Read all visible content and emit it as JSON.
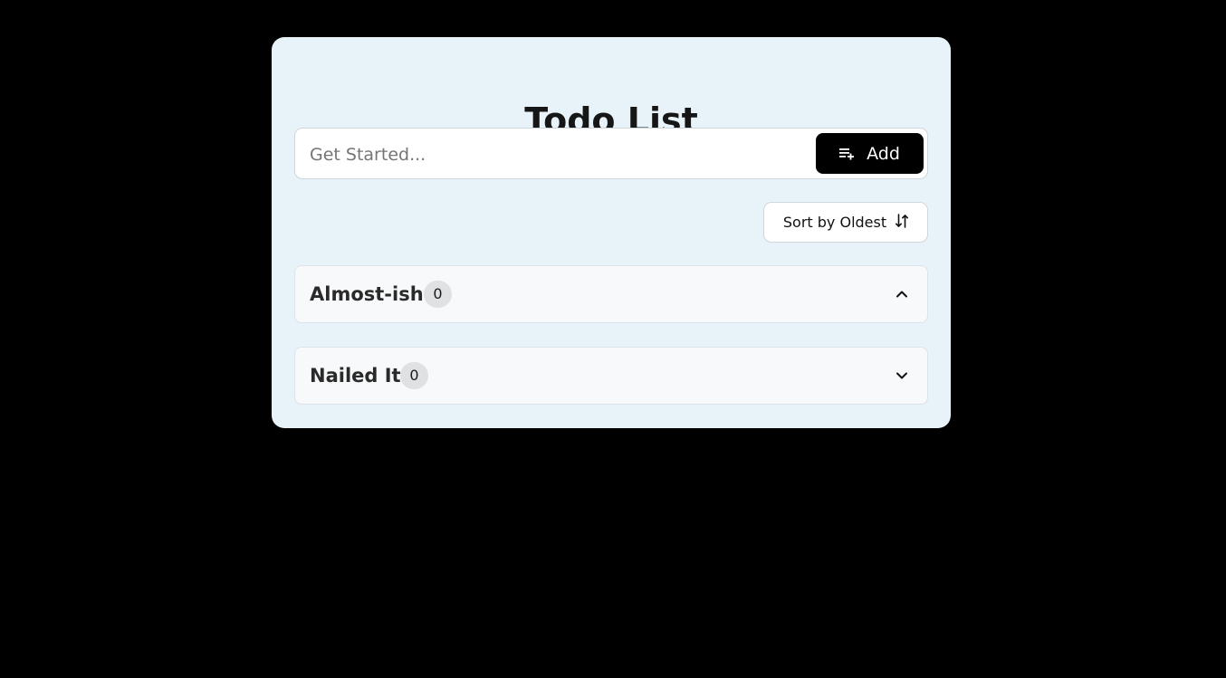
{
  "app": {
    "title": "Todo List"
  },
  "input": {
    "placeholder": "Get Started...",
    "value": ""
  },
  "add_button": {
    "label": "Add",
    "icon": "playlist-add-icon"
  },
  "sort_button": {
    "label": "Sort by Oldest",
    "icon": "sort-arrows-icon"
  },
  "sections": [
    {
      "label": "Almost-ish",
      "count": "0",
      "expanded": true,
      "icon": "chevron-up-icon"
    },
    {
      "label": "Nailed It",
      "count": "0",
      "expanded": false,
      "icon": "chevron-down-icon"
    }
  ],
  "colors": {
    "background": "#000000",
    "card": "#e8f2f9",
    "accent": "#000000",
    "section": "#f7f9fa",
    "badge": "#dfe1e3"
  }
}
